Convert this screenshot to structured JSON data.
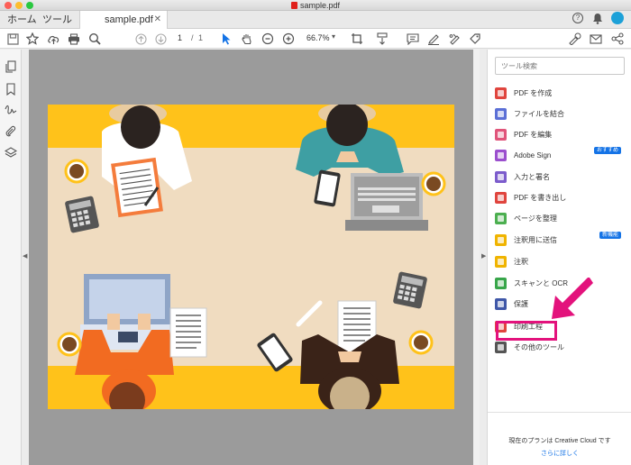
{
  "window": {
    "title": "sample.pdf"
  },
  "nav_tabs": [
    "ホーム",
    "ツール"
  ],
  "doc_tab": {
    "label": "sample.pdf",
    "close": "✕"
  },
  "header_icons": {
    "help": "?"
  },
  "toolbar": {
    "icons": [
      "save-icon",
      "bookmark-star-icon",
      "upload-cloud-icon",
      "print-icon",
      "zoom-search-icon",
      "prev-page-icon",
      "next-page-icon",
      "select-arrow-icon",
      "hand-icon",
      "zoom-out-icon",
      "zoom-in-icon",
      "crop-icon",
      "scroll-mode-icon",
      "comment-icon",
      "highlight-pen-icon",
      "sign-pen-icon",
      "fill-sign-icon",
      "protect-pen-icon",
      "mail-icon",
      "share-icon"
    ],
    "page_current": "1",
    "page_sep": "/",
    "page_total": "1",
    "zoom": "66.7%"
  },
  "search": {
    "placeholder": "ツール検索"
  },
  "tools": [
    {
      "label": "PDF を作成",
      "color": "#e0453e",
      "badge": ""
    },
    {
      "label": "ファイルを結合",
      "color": "#5b6fd6",
      "badge": ""
    },
    {
      "label": "PDF を編集",
      "color": "#e0547a",
      "badge": ""
    },
    {
      "label": "Adobe Sign",
      "color": "#9b4fce",
      "badge": "おすすめ"
    },
    {
      "label": "入力と署名",
      "color": "#7c5ccc",
      "badge": ""
    },
    {
      "label": "PDF を書き出し",
      "color": "#e0453e",
      "badge": ""
    },
    {
      "label": "ページを整理",
      "color": "#4caf50",
      "badge": ""
    },
    {
      "label": "注釈用に送信",
      "color": "#f0b400",
      "badge": "新機能"
    },
    {
      "label": "注釈",
      "color": "#f0b400",
      "badge": ""
    },
    {
      "label": "スキャンと OCR",
      "color": "#38a64a",
      "badge": ""
    },
    {
      "label": "保護",
      "color": "#3f57a8",
      "badge": ""
    },
    {
      "label": "印刷工程",
      "color": "#e0453e",
      "badge": ""
    },
    {
      "label": "その他のツール",
      "color": "#555555",
      "badge": ""
    }
  ],
  "footer": {
    "plan_text": "現在のプランは Creative Cloud です",
    "link": "さらに詳しく"
  },
  "colors": {
    "accent": "#1473e6",
    "highlight": "#e3127c",
    "page_bg": "#f0dcc0",
    "table_stripe": "#ffc21a"
  }
}
